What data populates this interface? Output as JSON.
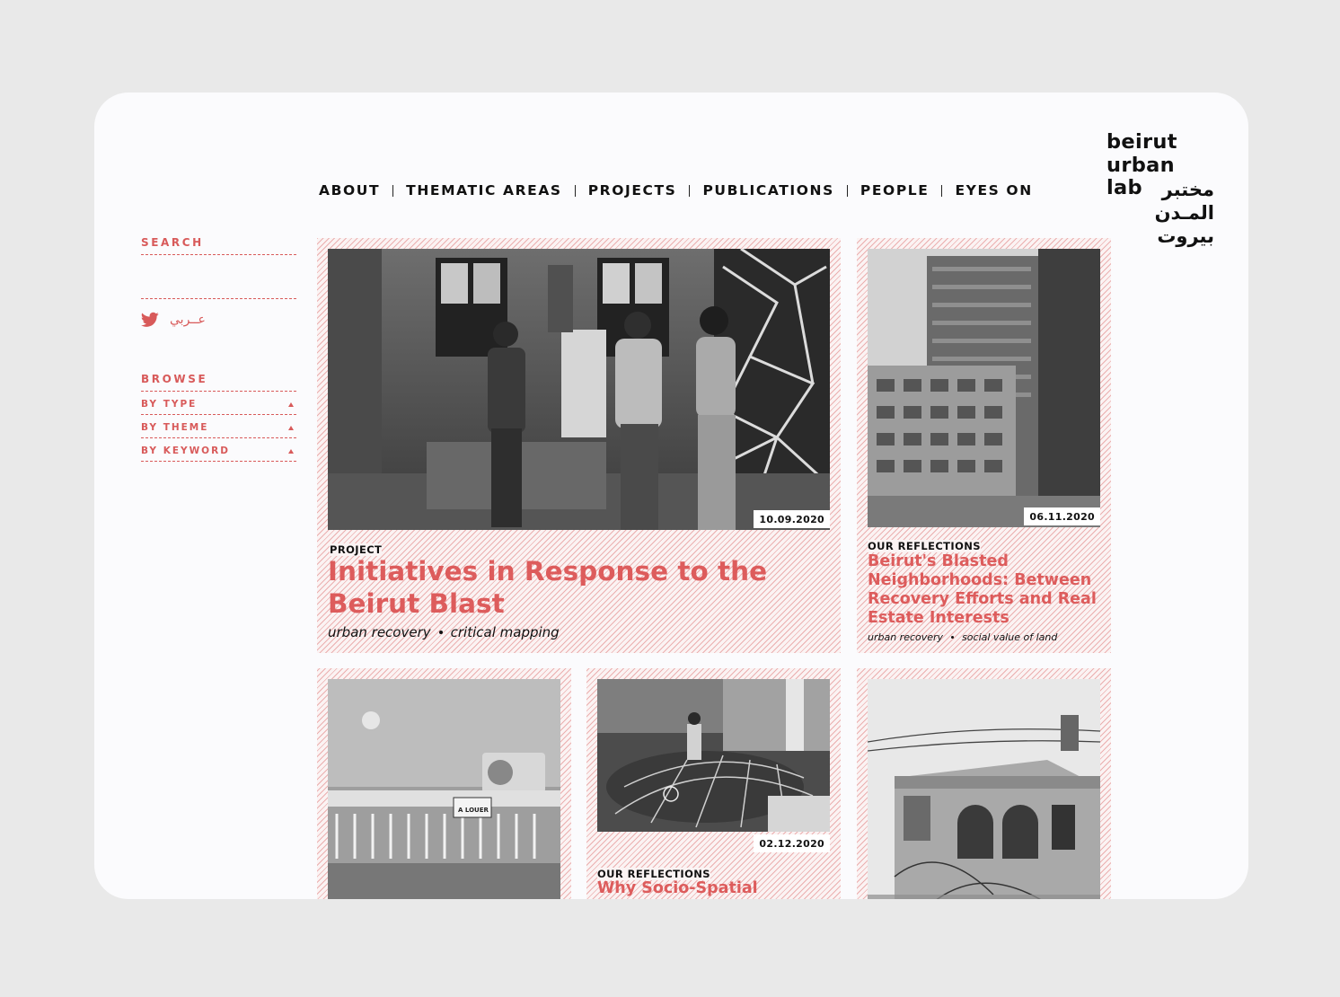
{
  "nav": {
    "items": [
      "ABOUT",
      "THEMATIC AREAS",
      "PROJECTS",
      "PUBLICATIONS",
      "PEOPLE",
      "EYES ON"
    ]
  },
  "logo": {
    "en_lines": [
      "beirut",
      "urban",
      "lab"
    ],
    "ar_lines": [
      "مختبر",
      "المـدن",
      "بيروت"
    ]
  },
  "sidebar": {
    "search_label": "SEARCH",
    "arabic_link": "عــربي",
    "browse_label": "BROWSE",
    "browse_items": [
      "BY TYPE",
      "BY THEME",
      "BY KEYWORD"
    ]
  },
  "cards": [
    {
      "date": "10.09.2020",
      "type": "PROJECT",
      "title": "Initiatives in Response to the Beirut Blast",
      "tags": [
        "urban recovery",
        "critical mapping"
      ]
    },
    {
      "date": "06.11.2020",
      "type": "OUR REFLECTIONS",
      "title": "Beirut's Blasted Neighborhoods: Between Recovery Efforts and Real Estate Interests",
      "tags": [
        "urban recovery",
        "social value of land"
      ]
    },
    {
      "date": "",
      "type": "",
      "title": ""
    },
    {
      "date": "02.12.2020",
      "type": "OUR REFLECTIONS",
      "title": "Why Socio-Spatial"
    },
    {
      "date": "",
      "type": "",
      "title": ""
    }
  ],
  "photo_signs": [
    "A LOUER"
  ],
  "colors": {
    "accent": "#dd5c5c",
    "text": "#111111",
    "window": "#fbfbfd",
    "backdrop": "#e9e9e9"
  }
}
